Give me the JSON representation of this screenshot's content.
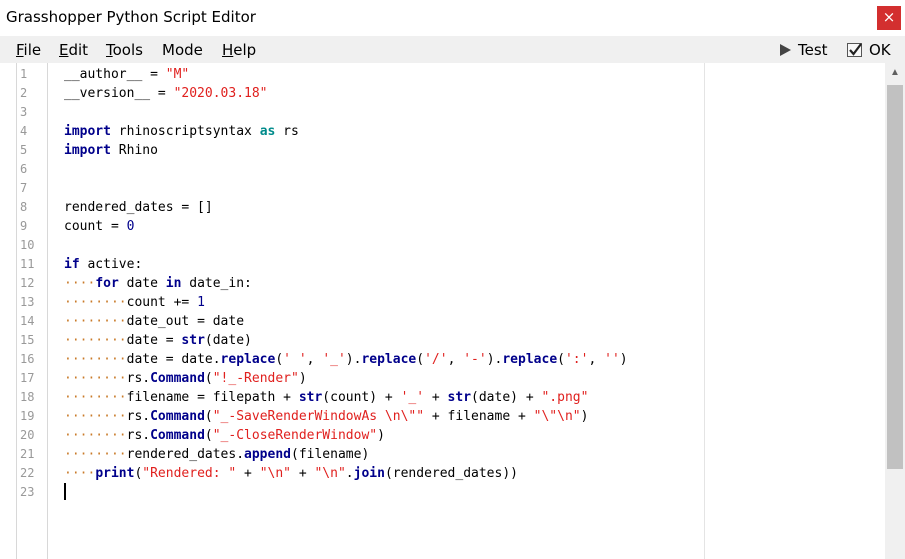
{
  "window": {
    "title": "Grasshopper Python Script Editor",
    "close_glyph": "×"
  },
  "menu": {
    "items": [
      {
        "accel": "F",
        "rest": "ile"
      },
      {
        "accel": "E",
        "rest": "dit"
      },
      {
        "accel": "T",
        "rest": "ools"
      },
      {
        "accel": "",
        "rest": "Mode"
      },
      {
        "accel": "H",
        "rest": "elp"
      }
    ]
  },
  "toolbar": {
    "test_label": "Test",
    "ok_label": "OK"
  },
  "editor": {
    "lines": [
      {
        "n": "1",
        "segs": [
          [
            "",
            "__author__ = "
          ],
          [
            "str",
            "\"M\""
          ]
        ]
      },
      {
        "n": "2",
        "segs": [
          [
            "",
            "__version__ = "
          ],
          [
            "str",
            "\"2020.03.18\""
          ]
        ]
      },
      {
        "n": "3",
        "segs": []
      },
      {
        "n": "4",
        "segs": [
          [
            "kw",
            "import"
          ],
          [
            "",
            " rhinoscriptsyntax "
          ],
          [
            "kw2",
            "as"
          ],
          [
            "",
            " rs"
          ]
        ]
      },
      {
        "n": "5",
        "segs": [
          [
            "kw",
            "import"
          ],
          [
            "",
            " Rhino"
          ]
        ]
      },
      {
        "n": "6",
        "segs": []
      },
      {
        "n": "7",
        "segs": []
      },
      {
        "n": "8",
        "segs": [
          [
            "",
            "rendered_dates = []"
          ]
        ]
      },
      {
        "n": "9",
        "segs": [
          [
            "",
            "count = "
          ],
          [
            "num",
            "0"
          ]
        ]
      },
      {
        "n": "10",
        "segs": []
      },
      {
        "n": "11",
        "segs": [
          [
            "kw",
            "if"
          ],
          [
            "",
            " active:"
          ]
        ]
      },
      {
        "n": "12",
        "segs": [
          [
            "ws",
            "····"
          ],
          [
            "kw",
            "for"
          ],
          [
            "",
            " date "
          ],
          [
            "kw",
            "in"
          ],
          [
            "",
            " date_in:"
          ]
        ]
      },
      {
        "n": "13",
        "segs": [
          [
            "ws",
            "········"
          ],
          [
            "",
            "count += "
          ],
          [
            "num",
            "1"
          ]
        ]
      },
      {
        "n": "14",
        "segs": [
          [
            "ws",
            "········"
          ],
          [
            "",
            "date_out = date"
          ]
        ]
      },
      {
        "n": "15",
        "segs": [
          [
            "ws",
            "········"
          ],
          [
            "",
            "date = "
          ],
          [
            "fn",
            "str"
          ],
          [
            "",
            "(date)"
          ]
        ]
      },
      {
        "n": "16",
        "segs": [
          [
            "ws",
            "········"
          ],
          [
            "",
            "date = date."
          ],
          [
            "fn",
            "replace"
          ],
          [
            "",
            "("
          ],
          [
            "str",
            "' '"
          ],
          [
            "",
            ", "
          ],
          [
            "str",
            "'_'"
          ],
          [
            "",
            ")."
          ],
          [
            "fn",
            "replace"
          ],
          [
            "",
            "("
          ],
          [
            "str",
            "'/'"
          ],
          [
            "",
            ", "
          ],
          [
            "str",
            "'-'"
          ],
          [
            "",
            ")."
          ],
          [
            "fn",
            "replace"
          ],
          [
            "",
            "("
          ],
          [
            "str",
            "':'"
          ],
          [
            "",
            ", "
          ],
          [
            "str",
            "''"
          ],
          [
            "",
            ")"
          ]
        ]
      },
      {
        "n": "17",
        "segs": [
          [
            "ws",
            "········"
          ],
          [
            "",
            "rs."
          ],
          [
            "fn",
            "Command"
          ],
          [
            "",
            "("
          ],
          [
            "str",
            "\"!_-Render\""
          ],
          [
            "",
            ")"
          ]
        ]
      },
      {
        "n": "18",
        "segs": [
          [
            "ws",
            "········"
          ],
          [
            "",
            "filename = filepath + "
          ],
          [
            "fn",
            "str"
          ],
          [
            "",
            "(count) + "
          ],
          [
            "str",
            "'_'"
          ],
          [
            "",
            " + "
          ],
          [
            "fn",
            "str"
          ],
          [
            "",
            "(date) + "
          ],
          [
            "str",
            "\".png\""
          ]
        ]
      },
      {
        "n": "19",
        "segs": [
          [
            "ws",
            "········"
          ],
          [
            "",
            "rs."
          ],
          [
            "fn",
            "Command"
          ],
          [
            "",
            "("
          ],
          [
            "str",
            "\"_-SaveRenderWindowAs \\n\\\"\""
          ],
          [
            "",
            " + filename + "
          ],
          [
            "str",
            "\"\\\"\\n\""
          ],
          [
            "",
            ")"
          ]
        ]
      },
      {
        "n": "20",
        "segs": [
          [
            "ws",
            "········"
          ],
          [
            "",
            "rs."
          ],
          [
            "fn",
            "Command"
          ],
          [
            "",
            "("
          ],
          [
            "str",
            "\"_-CloseRenderWindow\""
          ],
          [
            "",
            ")"
          ]
        ]
      },
      {
        "n": "21",
        "segs": [
          [
            "ws",
            "········"
          ],
          [
            "",
            "rendered_dates."
          ],
          [
            "fn",
            "append"
          ],
          [
            "",
            "(filename)"
          ]
        ]
      },
      {
        "n": "22",
        "segs": [
          [
            "ws",
            "····"
          ],
          [
            "kw",
            "print"
          ],
          [
            "",
            "("
          ],
          [
            "str",
            "\"Rendered: \""
          ],
          [
            "",
            " + "
          ],
          [
            "str",
            "\"\\n\""
          ],
          [
            "",
            " + "
          ],
          [
            "str",
            "\"\\n\""
          ],
          [
            "",
            "."
          ],
          [
            "fn",
            "join"
          ],
          [
            "",
            "(rendered_dates))"
          ]
        ]
      },
      {
        "n": "23",
        "segs": []
      }
    ]
  },
  "colors": {
    "keyword": "#00008b",
    "string": "#e0201e",
    "whitespace_marker": "#c97a28",
    "close_button": "#d32f2f"
  }
}
